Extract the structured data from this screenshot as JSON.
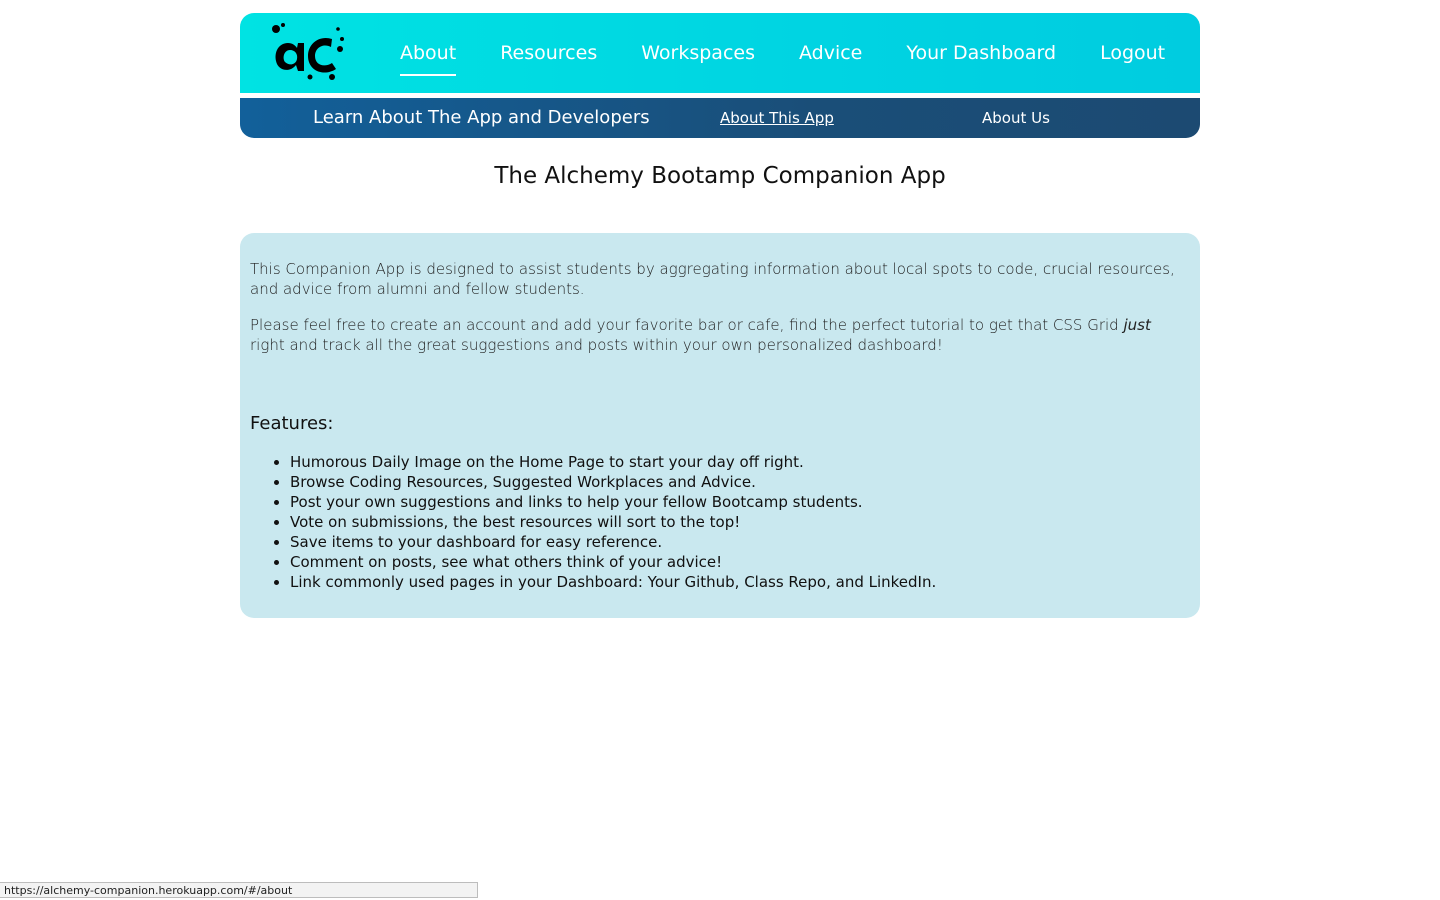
{
  "header": {
    "logo_alt": "aC",
    "nav": [
      {
        "label": "About",
        "active": true
      },
      {
        "label": "Resources",
        "active": false
      },
      {
        "label": "Workspaces",
        "active": false
      },
      {
        "label": "Advice",
        "active": false
      },
      {
        "label": "Your Dashboard",
        "active": false
      },
      {
        "label": "Logout",
        "active": false
      }
    ]
  },
  "subnav": {
    "title": "Learn About The App and Developers",
    "links": [
      {
        "label": "About This App",
        "current": true
      },
      {
        "label": "About Us",
        "current": false
      }
    ]
  },
  "main": {
    "title": "The Alchemy Bootamp Companion App",
    "intro_paragraph_1": "This Companion App is designed to assist students by aggregating information about local spots to code, crucial resources, and advice from alumni and fellow students.",
    "intro_paragraph_2_before": "Please feel free to create an account and add your favorite bar or cafe, find the perfect tutorial to get that CSS Grid ",
    "intro_paragraph_2_emphasis": "just",
    "intro_paragraph_2_after": " right and track all the great suggestions and posts within your own personalized dashboard!",
    "features_heading": "Features:",
    "features": [
      "Humorous Daily Image on the Home Page to start your day off right.",
      "Browse Coding Resources, Suggested Workplaces and Advice.",
      "Post your own suggestions and links to help your fellow Bootcamp students.",
      "Vote on submissions, the best resources will sort to the top!",
      "Save items to your dashboard for easy reference.",
      "Comment on posts, see what others think of your advice!",
      "Link commonly used pages in your Dashboard: Your Github, Class Repo, and LinkedIn."
    ]
  },
  "status_bar": {
    "url": "https://alchemy-companion.herokuapp.com/#/about"
  },
  "colors": {
    "topnav_gradient_start": "#00e3e3",
    "topnav_gradient_end": "#00cce0",
    "subnav_gradient_start": "#12609a",
    "subnav_gradient_end": "#1c4a72",
    "card_background": "#c9e8ef"
  }
}
